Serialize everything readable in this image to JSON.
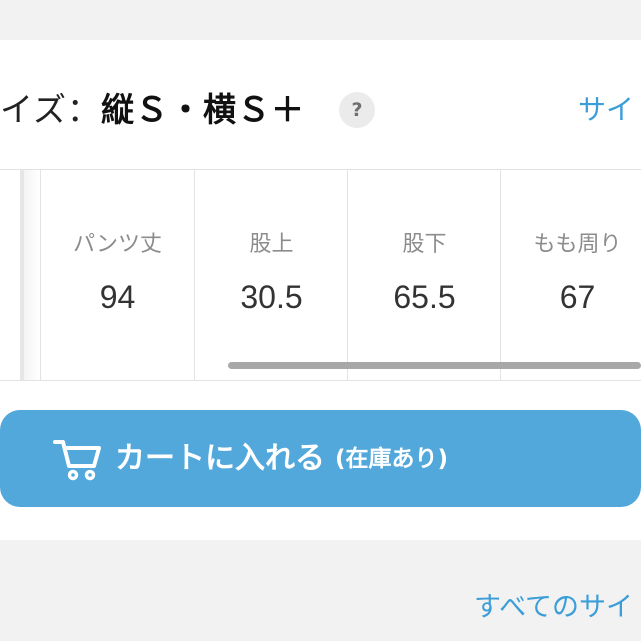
{
  "header": {
    "size_label": "イズ：",
    "size_value": "縦Ｓ・横Ｓ＋",
    "help_icon": "?",
    "size_chart_link": "サイ"
  },
  "size_table": {
    "columns": [
      {
        "label": "パンツ丈",
        "value": "94"
      },
      {
        "label": "股上",
        "value": "30.5"
      },
      {
        "label": "股下",
        "value": "65.5"
      },
      {
        "label": "もも周り",
        "value": "67"
      }
    ]
  },
  "cart_button": {
    "icon": "cart-icon",
    "label": "カートに入れる",
    "stock_status": "(在庫あり)"
  },
  "footer": {
    "all_sizes_link": "すべてのサイ"
  },
  "colors": {
    "button": "#52a8db",
    "link": "#3c9ed8",
    "label_gray": "#8c8c8c"
  }
}
